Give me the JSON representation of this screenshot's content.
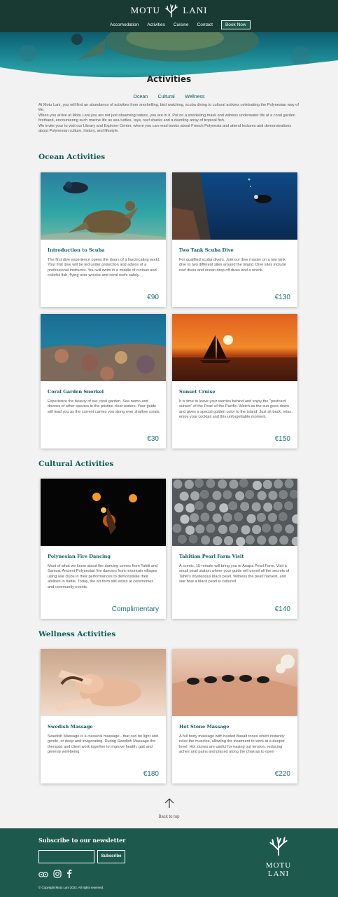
{
  "brand": {
    "name_left": "MOTU",
    "name_right": "LANI"
  },
  "nav": {
    "items": [
      "Accomodation",
      "Activities",
      "Cuisine",
      "Contact"
    ],
    "book": "Book Now"
  },
  "page": {
    "title": "Activities",
    "subnav": [
      "Ocean",
      "Cultural",
      "Wellness"
    ],
    "intro": [
      "At Motu Lani, you will find an abundance of activities from snorkelling, bird watching, scuba diving to cultural activies celebrating the Polynesian way of life.",
      "When you arrive at Motu Lani you are not just observing nature, you are in it. Put on a snorkeling mask and witness underwater life at a coral garden firsthand, encountering such marine life as sea turtles, rays, reef sharks and a dazzling array of tropical fish.",
      "We invite your to visit our Library and Explorer Center, where you can read books about French Polynesia and attend lectures and demonstrations about Polynesian culture, history, and lifestyle."
    ]
  },
  "sections": {
    "ocean": "Ocean Activities",
    "cultural": "Cultural Activities",
    "wellness": "Wellness Activities"
  },
  "cards": [
    {
      "title": "Introduction to Scuba",
      "desc": "The first dive experience opens the doors of a fascincating world. Your first dive will be led under protection and advice of a professional instructor. You will swim in a middle of curious and colorful fish, flying over wrecks and coral reefs safely.",
      "price": "€90",
      "image": "turtle-diver"
    },
    {
      "title": "Two Tank Scuba Dive",
      "desc": "For qualified scuba divers. Join our dive master on a two tank dive to two different sites around the island. Dive sites include reef dives and ocean drop off dives and a wreck.",
      "price": "€130",
      "image": "deep-diver"
    },
    {
      "title": "Coral Garden Snorkel",
      "desc": "Experience the beauty of our coral garden. See nemo and dozens of other species in the pristine clear waters. Your guide will lead you as the current carries you along over shallow corals.",
      "price": "€30",
      "image": "coral-reef"
    },
    {
      "title": "Sunset Cruise",
      "desc": "It is time to leave your worries behind and enjoy the \"postcard sunset\" of the Pearl of the Pacific. Watch as the sun goes down and gives a special golden color to the island. Just sit back, relax, enjoy your cocktail and this unforgettable moment.",
      "price": "€150",
      "image": "sunset-sailboat"
    },
    {
      "title": "Polynesian Fire Dancing",
      "desc": "Most of what we know about fire dancing comes from Tahiti and Samoa. Ancient Polynesian fire dancers from mountain villages using war clubs in their performances to demonstrate their abilities in battle. Today, the art form still exists at ceremonies and community events.",
      "price": "Complimentary",
      "image": "fire-dancer"
    },
    {
      "title": "Tahitian Pearl Farm Visit",
      "desc": "A scenic, 15-minute will bring you to Anapa Pearl Farm. Visit a small pearl station where your guide will unveil all the secrets of Tahiti's mysterious black pearl. Witness the pearl harvest, and see how a black pearl is cultured.",
      "price": "€140",
      "image": "black-pearls"
    },
    {
      "title": "Swedish Massage",
      "desc": "Swedish Massage is a classical massage - that can be light and gentle, or deep and invigorating. During Swedish Massage the therapist and client work together to improve health, gait and general well-being",
      "price": "€180",
      "image": "face-massage"
    },
    {
      "title": "Hot Stone Massage",
      "desc": "A full body massage with heated Basalt tones which instantly relax the muscles, allowing the treatment to work at a deeper level. Hot stones are useful for easing out tension, reducing aches and pains and placed along the chakras to open",
      "price": "€220",
      "image": "hot-stones"
    }
  ],
  "back_to_top": "Back to top",
  "footer": {
    "newsletter_title": "Subscribe to our newsletter",
    "subscribe": "Subscribe",
    "copyright": "© Copyright Motu Lani 2022. All rights reserved.",
    "brand": "MOTU LANI",
    "social_icons": [
      "tripadvisor-icon",
      "instagram-icon",
      "facebook-icon"
    ]
  },
  "colors": {
    "header": "#183a33",
    "footer": "#1d5a4d",
    "accent": "#0d5c56",
    "price": "#1c6e78"
  }
}
